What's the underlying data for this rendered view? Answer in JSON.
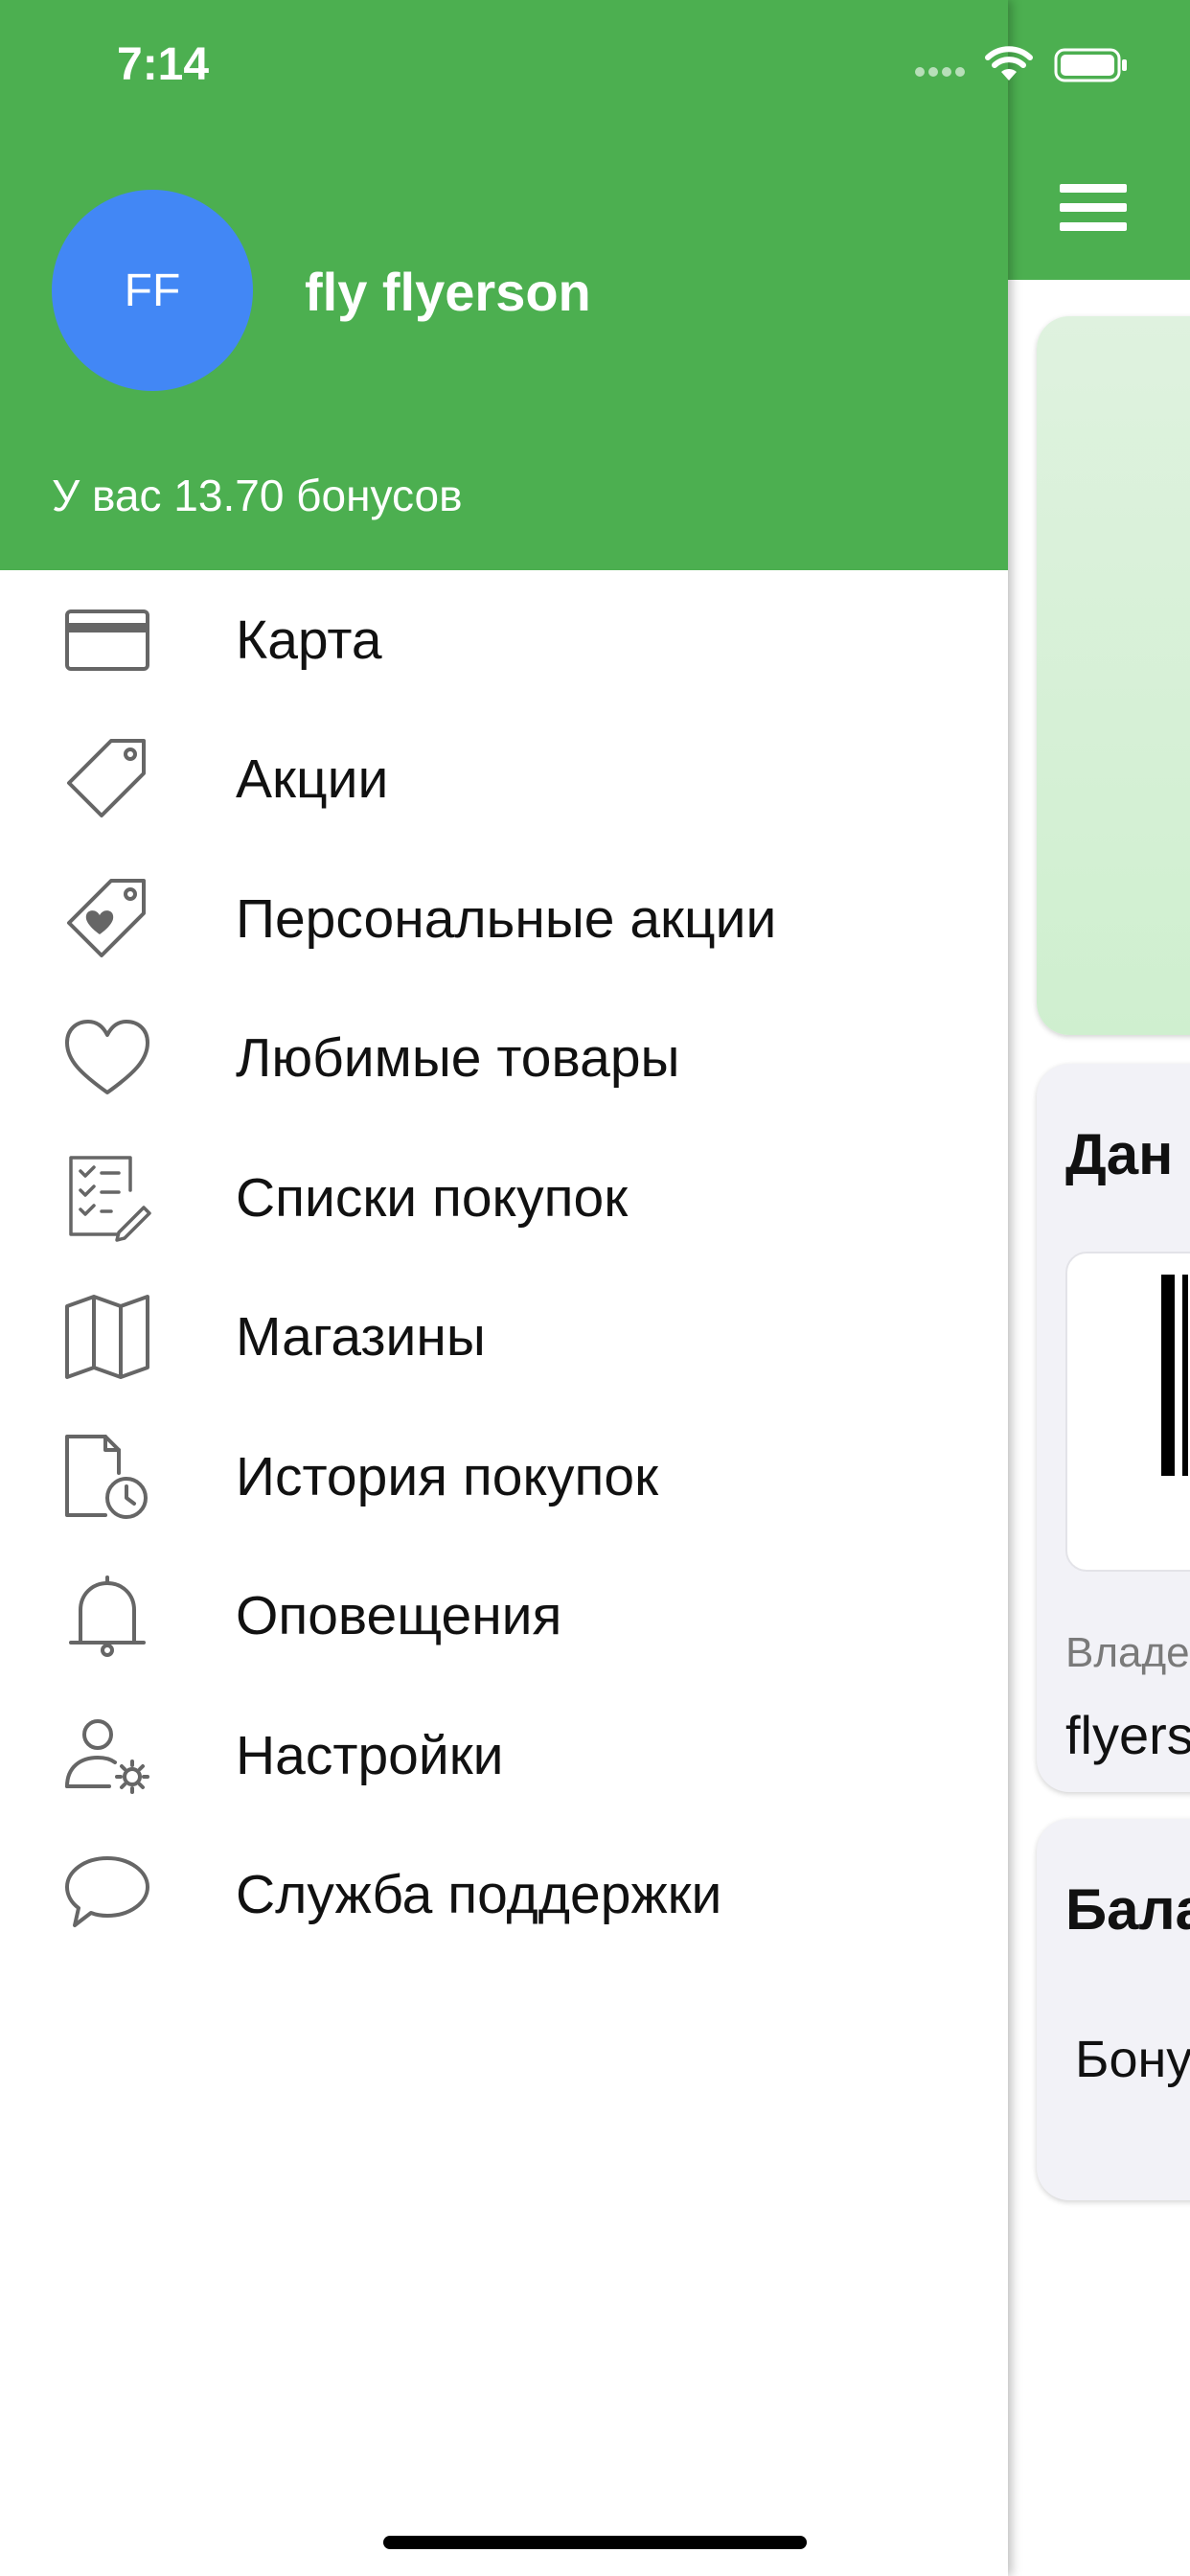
{
  "status_bar": {
    "time": "7:14"
  },
  "drawer": {
    "avatar_initials": "FF",
    "user_name": "fly flyerson",
    "bonus_text": "У вас 13.70 бонусов",
    "menu": [
      {
        "label": "Карта",
        "icon": "credit-card-icon"
      },
      {
        "label": "Акции",
        "icon": "tag-icon"
      },
      {
        "label": "Персональные акции",
        "icon": "heart-tag-icon"
      },
      {
        "label": "Любимые товары",
        "icon": "heart-icon"
      },
      {
        "label": "Списки покупок",
        "icon": "checklist-icon"
      },
      {
        "label": "Магазины",
        "icon": "map-icon"
      },
      {
        "label": "История покупок",
        "icon": "history-icon"
      },
      {
        "label": "Оповещения",
        "icon": "bell-icon"
      },
      {
        "label": "Настройки",
        "icon": "user-settings-icon"
      },
      {
        "label": "Служба поддержки",
        "icon": "chat-icon"
      }
    ]
  },
  "main": {
    "data_card_title": "Дан",
    "owner_label": "Владе",
    "owner_value": "flyers",
    "balance_title": "Бала",
    "balance_row": "Бону"
  },
  "colors": {
    "header_green": "#4caf50",
    "avatar_blue": "#4287f5",
    "icon_gray": "#666666"
  }
}
